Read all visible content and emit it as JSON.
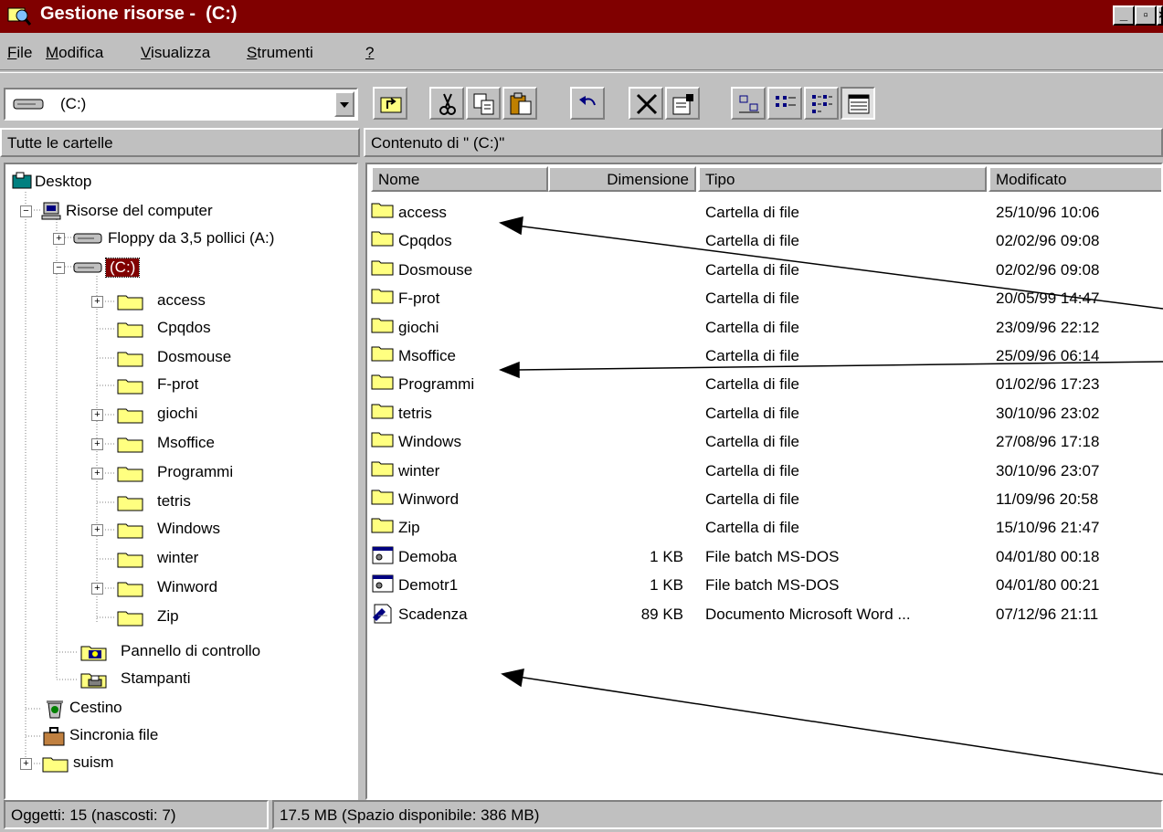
{
  "window": {
    "title": "Gestione risorse -  (C:)"
  },
  "menu": {
    "items": [
      {
        "label": "File",
        "u": "F",
        "rest": "ile"
      },
      {
        "label": "Modifica",
        "u": "M",
        "rest": "odifica"
      },
      {
        "label": "Visualizza",
        "u": "V",
        "rest": "isualizza"
      },
      {
        "label": "Strumenti",
        "u": "S",
        "rest": "trumenti"
      },
      {
        "label": "?",
        "u": "?",
        "rest": ""
      }
    ]
  },
  "drive_combo": {
    "value": "(C:)"
  },
  "panels": {
    "tree_header": "Tutte le cartelle",
    "contents_header": "Contenuto di \" (C:)\""
  },
  "tree": {
    "desktop": "Desktop",
    "computer": "Risorse del computer",
    "floppy": "Floppy da 3,5 pollici (A:)",
    "drive_c": "(C:)",
    "folders": [
      "access",
      "Cpqdos",
      "Dosmouse",
      "F-prot",
      "giochi",
      "Msoffice",
      "Programmi",
      "tetris",
      "Windows",
      "winter",
      "Winword",
      "Zip"
    ],
    "control_panel": "Pannello di controllo",
    "printers": "Stampanti",
    "recycle": "Cestino",
    "briefcase": "Sincronia file",
    "suism": "suism"
  },
  "columns": {
    "name": "Nome",
    "size": "Dimensione",
    "type": "Tipo",
    "modified": "Modificato"
  },
  "files": [
    {
      "name": "access",
      "size": "",
      "type": "Cartella di file",
      "modified": "25/10/96 10:06",
      "icon": "folder-icon"
    },
    {
      "name": "Cpqdos",
      "size": "",
      "type": "Cartella di file",
      "modified": "02/02/96 09:08",
      "icon": "folder-icon"
    },
    {
      "name": "Dosmouse",
      "size": "",
      "type": "Cartella di file",
      "modified": "02/02/96 09:08",
      "icon": "folder-icon"
    },
    {
      "name": "F-prot",
      "size": "",
      "type": "Cartella di file",
      "modified": "20/05/99 14:47",
      "icon": "folder-icon"
    },
    {
      "name": "giochi",
      "size": "",
      "type": "Cartella di file",
      "modified": "23/09/96 22:12",
      "icon": "folder-icon"
    },
    {
      "name": "Msoffice",
      "size": "",
      "type": "Cartella di file",
      "modified": "25/09/96 06:14",
      "icon": "folder-icon"
    },
    {
      "name": "Programmi",
      "size": "",
      "type": "Cartella di file",
      "modified": "01/02/96 17:23",
      "icon": "folder-icon"
    },
    {
      "name": "tetris",
      "size": "",
      "type": "Cartella di file",
      "modified": "30/10/96 23:02",
      "icon": "folder-icon"
    },
    {
      "name": "Windows",
      "size": "",
      "type": "Cartella di file",
      "modified": "27/08/96 17:18",
      "icon": "folder-icon"
    },
    {
      "name": "winter",
      "size": "",
      "type": "Cartella di file",
      "modified": "30/10/96 23:07",
      "icon": "folder-icon"
    },
    {
      "name": "Winword",
      "size": "",
      "type": "Cartella di file",
      "modified": "11/09/96 20:58",
      "icon": "folder-icon"
    },
    {
      "name": "Zip",
      "size": "",
      "type": "Cartella di file",
      "modified": "15/10/96 21:47",
      "icon": "folder-icon"
    },
    {
      "name": "Demoba",
      "size": "1 KB",
      "type": "File batch MS-DOS",
      "modified": "04/01/80 00:18",
      "icon": "batch-file-icon"
    },
    {
      "name": "Demotr1",
      "size": "1 KB",
      "type": "File batch MS-DOS",
      "modified": "04/01/80 00:21",
      "icon": "batch-file-icon"
    },
    {
      "name": "Scadenza",
      "size": "89 KB",
      "type": "Documento Microsoft Word ...",
      "modified": "07/12/96 21:11",
      "icon": "word-document-icon"
    }
  ],
  "status": {
    "objects": "Oggetti: 15 (nascosti: 7)",
    "space": "17.5 MB (Spazio disponibile: 386 MB)"
  },
  "colors": {
    "titlebar": "#800000",
    "face": "#c0c0c0",
    "selection": "#800000",
    "folder": "#ffff80"
  }
}
